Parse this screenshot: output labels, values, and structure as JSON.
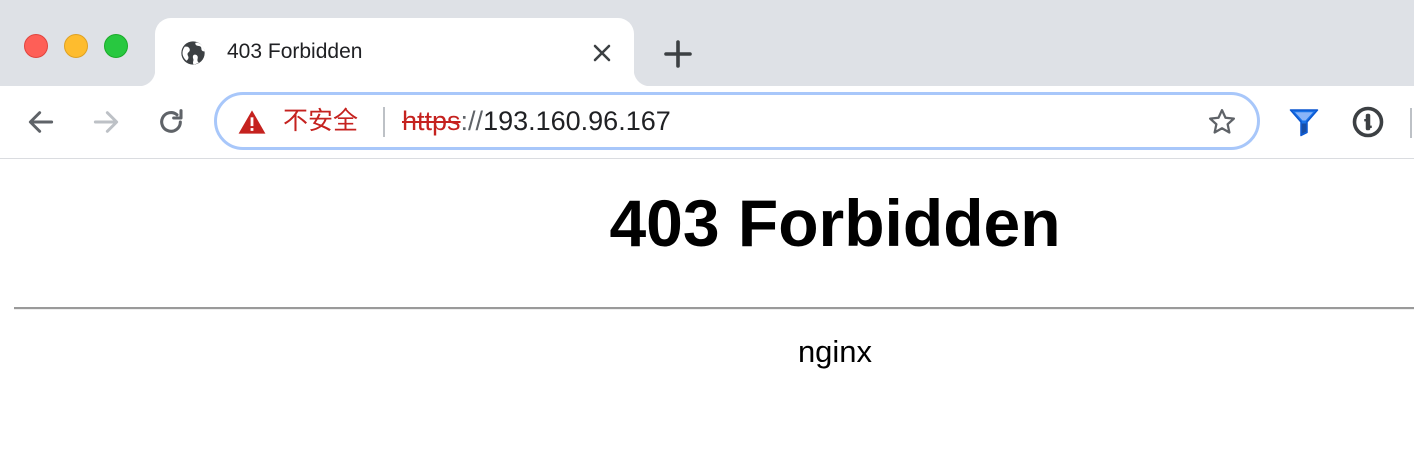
{
  "window": {
    "controls": [
      "close",
      "minimize",
      "maximize"
    ]
  },
  "tab": {
    "title": "403 Forbidden",
    "favicon": "globe-icon",
    "close_icon": "close-icon"
  },
  "new_tab": {
    "icon": "plus-icon"
  },
  "toolbar": {
    "back_icon": "arrow-left-icon",
    "forward_icon": "arrow-right-icon",
    "reload_icon": "reload-icon",
    "bookmark_icon": "star-outline-icon",
    "extensions": [
      {
        "icon": "funnel-icon"
      },
      {
        "icon": "password-manager-icon"
      }
    ]
  },
  "omnibox": {
    "security_icon": "warning-triangle-icon",
    "security_label": "不安全",
    "url_scheme": "https",
    "url_separator": "://",
    "url_host": "193.160.96.167"
  },
  "page": {
    "heading": "403 Forbidden",
    "server": "nginx"
  },
  "colors": {
    "tabstrip_bg": "#dee1e6",
    "insecure_red": "#c5221f",
    "focus_ring": "#a8c7fa",
    "icon_gray": "#5f6368"
  }
}
